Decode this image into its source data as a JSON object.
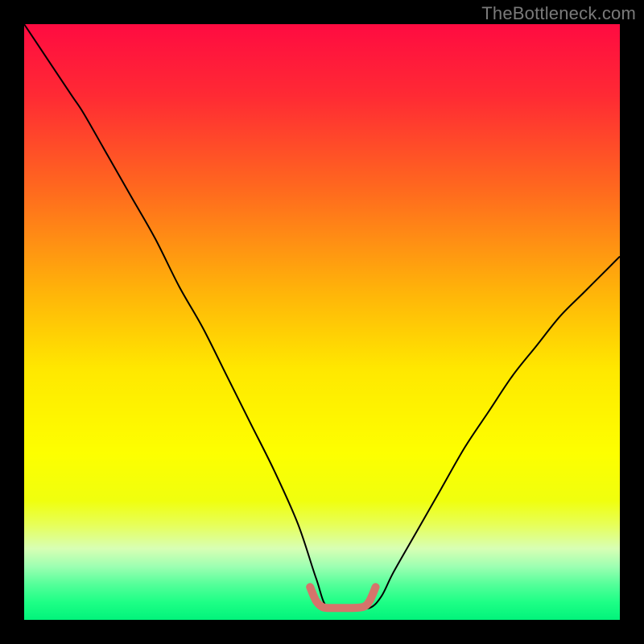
{
  "watermark": "TheBottleneck.com",
  "chart_data": {
    "type": "line",
    "title": "",
    "xlabel": "",
    "ylabel": "",
    "xlim": [
      0,
      100
    ],
    "ylim": [
      0,
      100
    ],
    "legend": false,
    "grid": false,
    "gradient_stops": [
      {
        "pct": 0,
        "color": "#ff0b41"
      },
      {
        "pct": 12,
        "color": "#ff2a34"
      },
      {
        "pct": 28,
        "color": "#ff6a1e"
      },
      {
        "pct": 45,
        "color": "#ffb409"
      },
      {
        "pct": 58,
        "color": "#ffe800"
      },
      {
        "pct": 72,
        "color": "#fdff00"
      },
      {
        "pct": 80,
        "color": "#f0ff0e"
      },
      {
        "pct": 84,
        "color": "#e7ff58"
      },
      {
        "pct": 88,
        "color": "#d8ffb4"
      },
      {
        "pct": 91,
        "color": "#9effb2"
      },
      {
        "pct": 94,
        "color": "#55ff9a"
      },
      {
        "pct": 97,
        "color": "#1eff86"
      },
      {
        "pct": 100,
        "color": "#02f37b"
      }
    ],
    "series": [
      {
        "name": "bottleneck-curve",
        "color": "#000000",
        "width": 2,
        "x": [
          0,
          4,
          8,
          10,
          14,
          18,
          22,
          26,
          30,
          34,
          38,
          42,
          46,
          49,
          51,
          55,
          58,
          60,
          62,
          66,
          70,
          74,
          78,
          82,
          86,
          90,
          94,
          98,
          100
        ],
        "y": [
          100,
          94,
          88,
          85,
          78,
          71,
          64,
          56,
          49,
          41,
          33,
          25,
          16,
          7,
          2,
          2,
          2,
          4,
          8,
          15,
          22,
          29,
          35,
          41,
          46,
          51,
          55,
          59,
          61
        ]
      },
      {
        "name": "flat-bottom-highlight",
        "color": "#d5746b",
        "width": 10,
        "linecap": "round",
        "x": [
          48,
          49,
          50,
          51,
          53,
          55,
          57,
          58,
          59
        ],
        "y": [
          5.5,
          3.2,
          2.2,
          2.0,
          2.0,
          2.0,
          2.2,
          3.2,
          5.5
        ]
      }
    ]
  }
}
